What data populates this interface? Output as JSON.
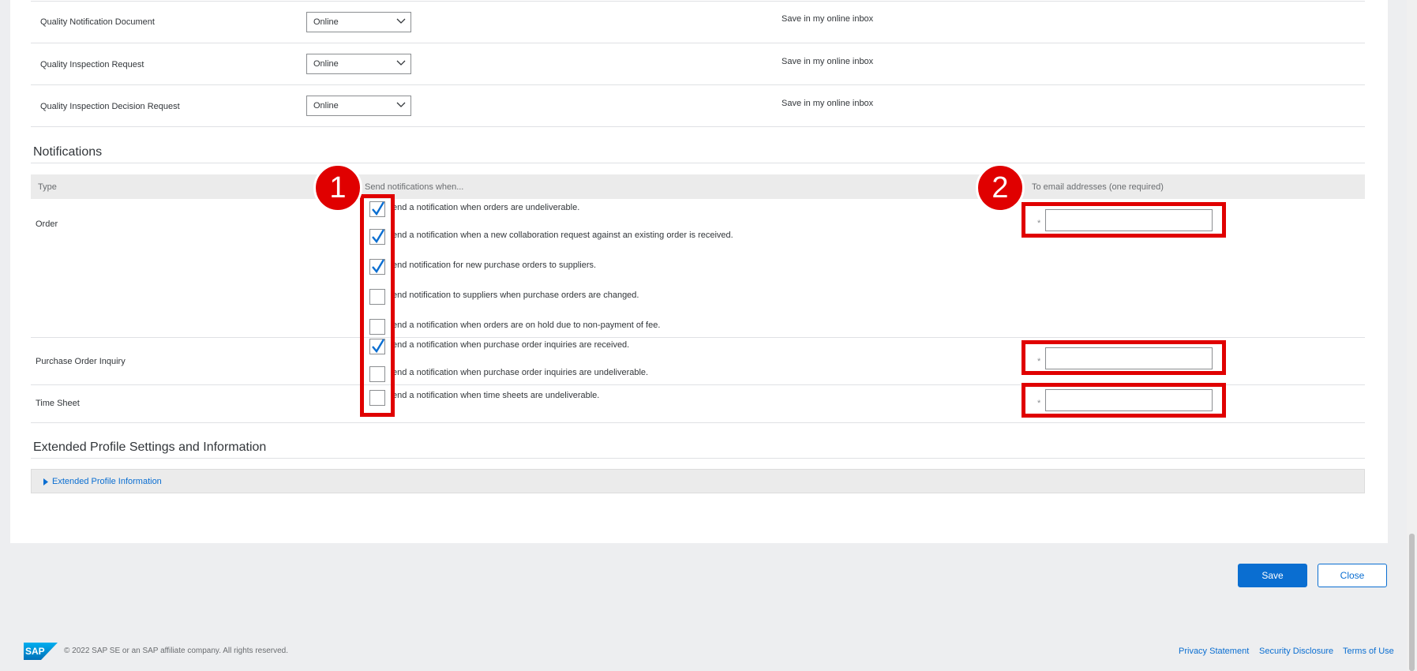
{
  "documents": [
    {
      "name": "Quality Notification Document",
      "format": "Online",
      "action": "Save in my online inbox"
    },
    {
      "name": "Quality Inspection Request",
      "format": "Online",
      "action": "Save in my online inbox"
    },
    {
      "name": "Quality Inspection Decision Request",
      "format": "Online",
      "action": "Save in my online inbox"
    }
  ],
  "notifications": {
    "title": "Notifications",
    "columns": {
      "type": "Type",
      "when": "Send notifications when...",
      "email": "To email addresses (one required)"
    },
    "groups": [
      {
        "type": "Order",
        "items": [
          {
            "label": "end a notification when orders are undeliverable.",
            "checked": true
          },
          {
            "label": "end a notification when a new collaboration request against an existing order is received.",
            "checked": true
          },
          {
            "label": "end notification for new purchase orders to suppliers.",
            "checked": true
          },
          {
            "label": "end notification to suppliers when purchase orders are changed.",
            "checked": false
          },
          {
            "label": "end a notification when orders are on hold due to non-payment of fee.",
            "checked": false
          }
        ],
        "email": ""
      },
      {
        "type": "Purchase Order Inquiry",
        "items": [
          {
            "label": "end a notification when purchase order inquiries are received.",
            "checked": true
          },
          {
            "label": "end a notification when purchase order inquiries are undeliverable.",
            "checked": false
          }
        ],
        "email": ""
      },
      {
        "type": "Time Sheet",
        "items": [
          {
            "label": "end a notification when time sheets are undeliverable.",
            "checked": false
          }
        ],
        "email": ""
      }
    ],
    "required_marker": "*"
  },
  "annotations": {
    "marker1": "1",
    "marker2": "2",
    "color": "#e00000"
  },
  "extended": {
    "title": "Extended Profile Settings and Information",
    "link": "Extended Profile Information"
  },
  "actions": {
    "save": "Save",
    "close": "Close"
  },
  "footer": {
    "logo": "SAP",
    "copyright": "© 2022 SAP SE or an SAP affiliate company. All rights reserved.",
    "links": [
      "Privacy Statement",
      "Security Disclosure",
      "Terms of Use"
    ]
  },
  "colors": {
    "accent": "#0a6ed1",
    "annotation": "#e00000",
    "text": "#32363a"
  }
}
